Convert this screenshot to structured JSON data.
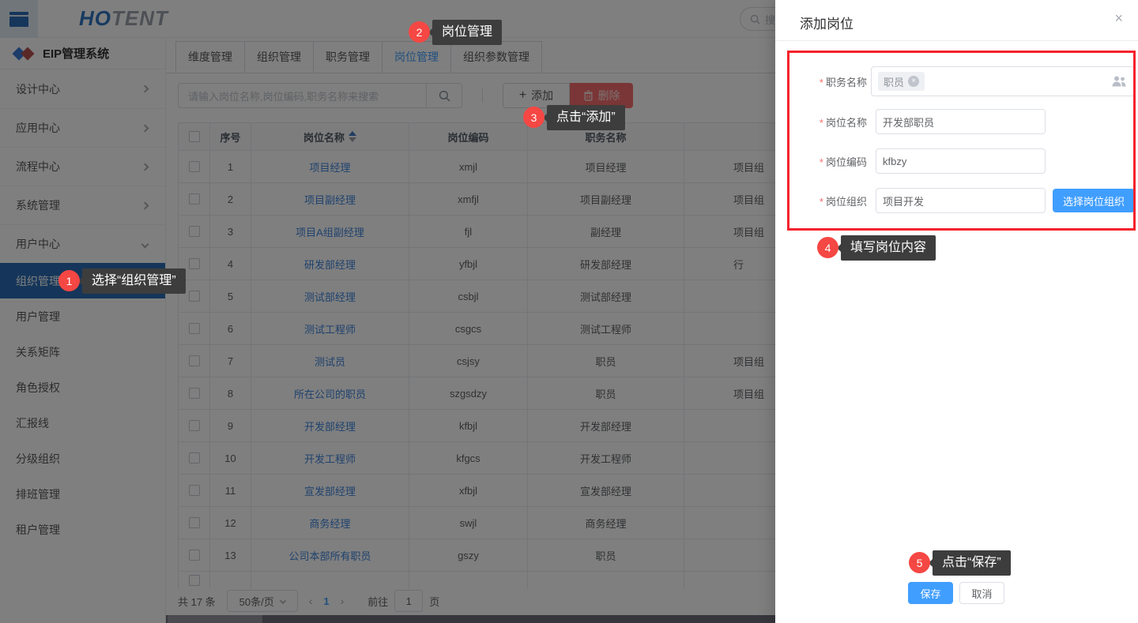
{
  "topbar": {
    "logo_primary": "HO",
    "logo_secondary": "TENT",
    "search_placeholder": "搜索"
  },
  "sidebar": {
    "system_title": "EIP管理系统",
    "groups": [
      {
        "label": "设计中心",
        "expanded": false
      },
      {
        "label": "应用中心",
        "expanded": false
      },
      {
        "label": "流程中心",
        "expanded": false
      },
      {
        "label": "系统管理",
        "expanded": false
      },
      {
        "label": "用户中心",
        "expanded": true
      }
    ],
    "items": [
      {
        "label": "组织管理",
        "active": true
      },
      {
        "label": "用户管理",
        "active": false
      },
      {
        "label": "关系矩阵",
        "active": false
      },
      {
        "label": "角色授权",
        "active": false
      },
      {
        "label": "汇报线",
        "active": false
      },
      {
        "label": "分级组织",
        "active": false
      },
      {
        "label": "排班管理",
        "active": false
      },
      {
        "label": "租户管理",
        "active": false
      }
    ]
  },
  "tabs": [
    {
      "label": "维度管理",
      "active": false
    },
    {
      "label": "组织管理",
      "active": false
    },
    {
      "label": "职务管理",
      "active": false
    },
    {
      "label": "岗位管理",
      "active": true
    },
    {
      "label": "组织参数管理",
      "active": false
    }
  ],
  "toolbar": {
    "search_placeholder": "请输入岗位名称,岗位编码,职务名称来搜索",
    "add_label": "添加",
    "delete_label": "删除"
  },
  "table": {
    "headers": {
      "index": "序号",
      "name": "岗位名称",
      "code": "岗位编码",
      "duty": "职务名称"
    },
    "rows": [
      {
        "no": "1",
        "name": "项目经理",
        "code": "xmjl",
        "duty": "项目经理",
        "org": "项目组"
      },
      {
        "no": "2",
        "name": "项目副经理",
        "code": "xmfjl",
        "duty": "项目副经理",
        "org": "项目组"
      },
      {
        "no": "3",
        "name": "项目A组副经理",
        "code": "fjl",
        "duty": "副经理",
        "org": "项目组"
      },
      {
        "no": "4",
        "name": "研发部经理",
        "code": "yfbjl",
        "duty": "研发部经理",
        "org": "行"
      },
      {
        "no": "5",
        "name": "测试部经理",
        "code": "csbjl",
        "duty": "测试部经理",
        "org": ""
      },
      {
        "no": "6",
        "name": "测试工程师",
        "code": "csgcs",
        "duty": "测试工程师",
        "org": ""
      },
      {
        "no": "7",
        "name": "测试员",
        "code": "csjsy",
        "duty": "职员",
        "org": "项目组"
      },
      {
        "no": "8",
        "name": "所在公司的职员",
        "code": "szgsdzy",
        "duty": "职员",
        "org": "项目组"
      },
      {
        "no": "9",
        "name": "开发部经理",
        "code": "kfbjl",
        "duty": "开发部经理",
        "org": ""
      },
      {
        "no": "10",
        "name": "开发工程师",
        "code": "kfgcs",
        "duty": "开发工程师",
        "org": ""
      },
      {
        "no": "11",
        "name": "宣发部经理",
        "code": "xfbjl",
        "duty": "宣发部经理",
        "org": ""
      },
      {
        "no": "12",
        "name": "商务经理",
        "code": "swjl",
        "duty": "商务经理",
        "org": ""
      },
      {
        "no": "13",
        "name": "公司本部所有职员",
        "code": "gszy",
        "duty": "职员",
        "org": ""
      }
    ]
  },
  "pagination": {
    "total_label": "共 17 条",
    "page_size": "50条/页",
    "prev": "‹",
    "current_page": "1",
    "next": "›",
    "goto_label": "前往",
    "goto_value": "1",
    "page_unit": "页"
  },
  "drawer": {
    "title": "添加岗位",
    "close_label": "×",
    "fields": [
      {
        "label": "职务名称",
        "tag": "职员"
      },
      {
        "label": "岗位名称",
        "value": "开发部职员"
      },
      {
        "label": "岗位编码",
        "value": "kfbzy"
      },
      {
        "label": "岗位组织",
        "value": "项目开发",
        "button": "选择岗位组织"
      }
    ],
    "save_label": "保存",
    "cancel_label": "取消"
  },
  "annotations": {
    "steps": [
      {
        "num": "1",
        "text": "选择“组织管理”"
      },
      {
        "num": "2",
        "text": "岗位管理"
      },
      {
        "num": "3",
        "text": "点击“添加”"
      },
      {
        "num": "4",
        "text": "填写岗位内容"
      },
      {
        "num": "5",
        "text": "点击“保存”"
      }
    ]
  },
  "colors": {
    "primary_blue": "#409eff",
    "sidebar_active_blue": "#2a6cb5",
    "danger_red": "#f56c6c",
    "annotation_red": "#f5222d",
    "badge_red": "#f54743",
    "tooltip_gray": "#3d3d3d",
    "link_blue": "#3e84dd"
  }
}
